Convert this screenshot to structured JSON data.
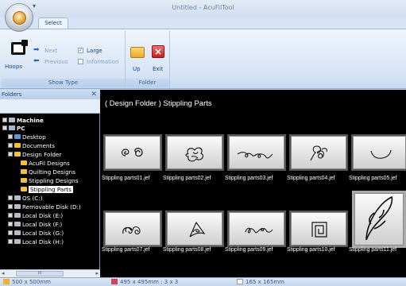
{
  "window": {
    "title": "Untitled - AcuFilTool",
    "qat_glyph": "▾"
  },
  "tabs": [
    {
      "label": "Select"
    }
  ],
  "ribbon": {
    "show_type": {
      "group_label": "Show Type",
      "hoops_label": "Hoops",
      "next_label": "Next",
      "previous_label": "Previous",
      "large_label": "Large",
      "large_checked": true,
      "information_label": "Information",
      "information_checked": false
    },
    "folder": {
      "group_label": "Folder",
      "up_label": "Up",
      "exit_label": "Exit"
    }
  },
  "folders_panel": {
    "title": "Folders",
    "close_glyph": "✕",
    "tree": [
      {
        "label": "Machine",
        "icon": "machine-icon"
      },
      {
        "label": "PC",
        "icon": "computer-icon"
      },
      {
        "label": "Desktop",
        "icon": "folder-icon"
      },
      {
        "label": "Documents",
        "icon": "folder-icon"
      },
      {
        "label": "Design Folder",
        "icon": "folder-icon"
      },
      {
        "label": "AcuFil Designs",
        "icon": "folder-icon"
      },
      {
        "label": "Quilting Designs",
        "icon": "folder-icon"
      },
      {
        "label": "Stippling Designs",
        "icon": "folder-icon"
      },
      {
        "label": "Stippling Parts",
        "icon": "folder-icon",
        "selected": true
      },
      {
        "label": "OS (C:)",
        "icon": "drive-icon"
      },
      {
        "label": "Removable Disk (D:)",
        "icon": "drive-icon"
      },
      {
        "label": "Local Disk (E:)",
        "icon": "drive-icon"
      },
      {
        "label": "Local Disk (F:)",
        "icon": "drive-icon"
      },
      {
        "label": "Local Disk (G:)",
        "icon": "drive-icon"
      },
      {
        "label": "Local Disk (H:)",
        "icon": "drive-icon"
      }
    ],
    "scroll_thumb_glyph": "III"
  },
  "gallery": {
    "title": "( Design Folder ) Stippling Parts",
    "items": [
      {
        "name": "Stippling parts01.jef"
      },
      {
        "name": "Stippling parts02.jef"
      },
      {
        "name": "Stippling parts03.jef"
      },
      {
        "name": "Stippling parts04.jef"
      },
      {
        "name": "Stippling parts05.jef"
      },
      {
        "name": "Stippling parts07.jef"
      },
      {
        "name": "Stippling parts08.jef"
      },
      {
        "name": "Stippling parts09.jef"
      },
      {
        "name": "Stippling parts10.jef"
      },
      {
        "name": "Stippling parts11.jef"
      }
    ]
  },
  "status": {
    "hoop_size": "500 x 500mm",
    "design_size": "495 x 495mm : 3 x 3",
    "part_size": "165 x 165mm",
    "colors": {
      "hoop": "#f0b030",
      "design": "#d04060",
      "part": "#ffffff"
    }
  }
}
